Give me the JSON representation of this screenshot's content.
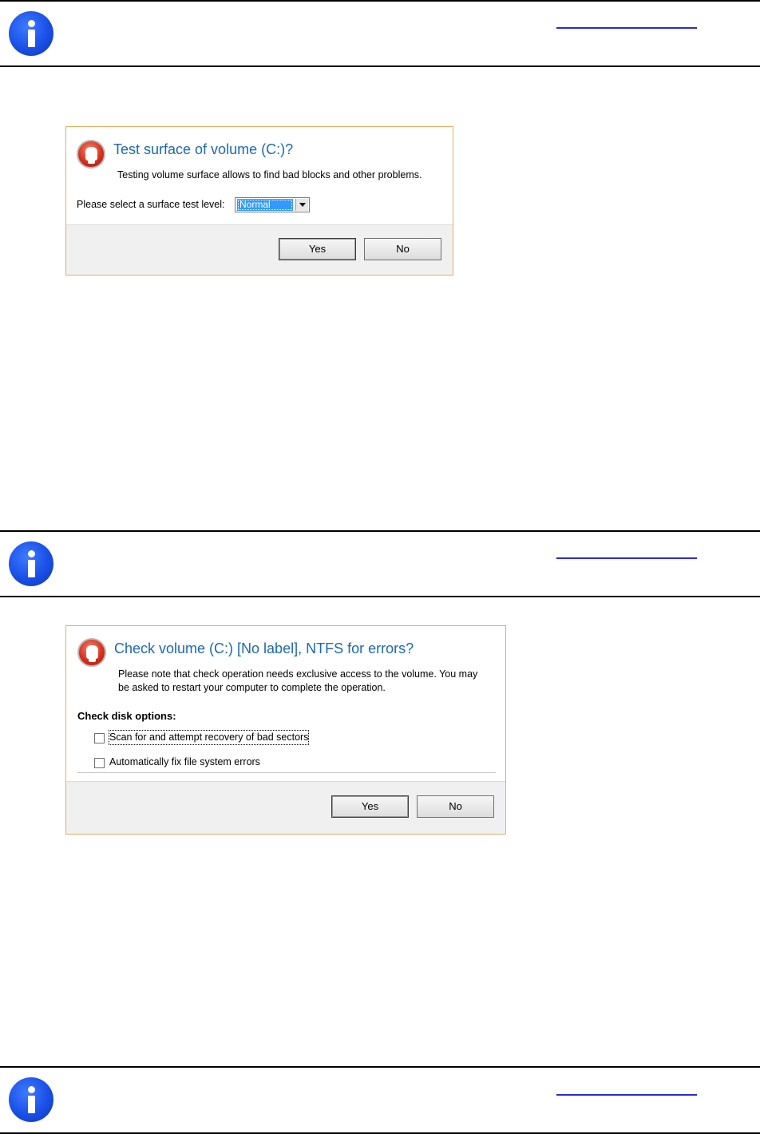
{
  "dialog1": {
    "title": "Test surface of volume (C:)?",
    "description": "Testing volume surface allows to find bad blocks and other problems.",
    "level_label": "Please select a surface test level:",
    "level_value": "Normal",
    "yes_label": "Yes",
    "no_label": "No"
  },
  "dialog2": {
    "title": "Check volume (C:) [No label], NTFS for errors?",
    "description_line1": "Please note that check operation needs exclusive access to the volume. You may",
    "description_line2": "be asked to restart your computer to complete the operation.",
    "options_heading": "Check disk options:",
    "option1_label": "Scan for and attempt recovery of bad sectors",
    "option1_checked": false,
    "option2_label": "Automatically fix file system errors",
    "option2_checked": false,
    "yes_label": "Yes",
    "no_label": "No"
  },
  "colors": {
    "title_blue": "#1c68b4",
    "info_icon_blue": "#1a4fe6",
    "dialog_border": "#e0b060",
    "selection_blue": "#3399ff"
  },
  "icons": {
    "info": "info-icon",
    "dialog": "program-logo-icon",
    "dropdown": "chevron-down-icon"
  }
}
